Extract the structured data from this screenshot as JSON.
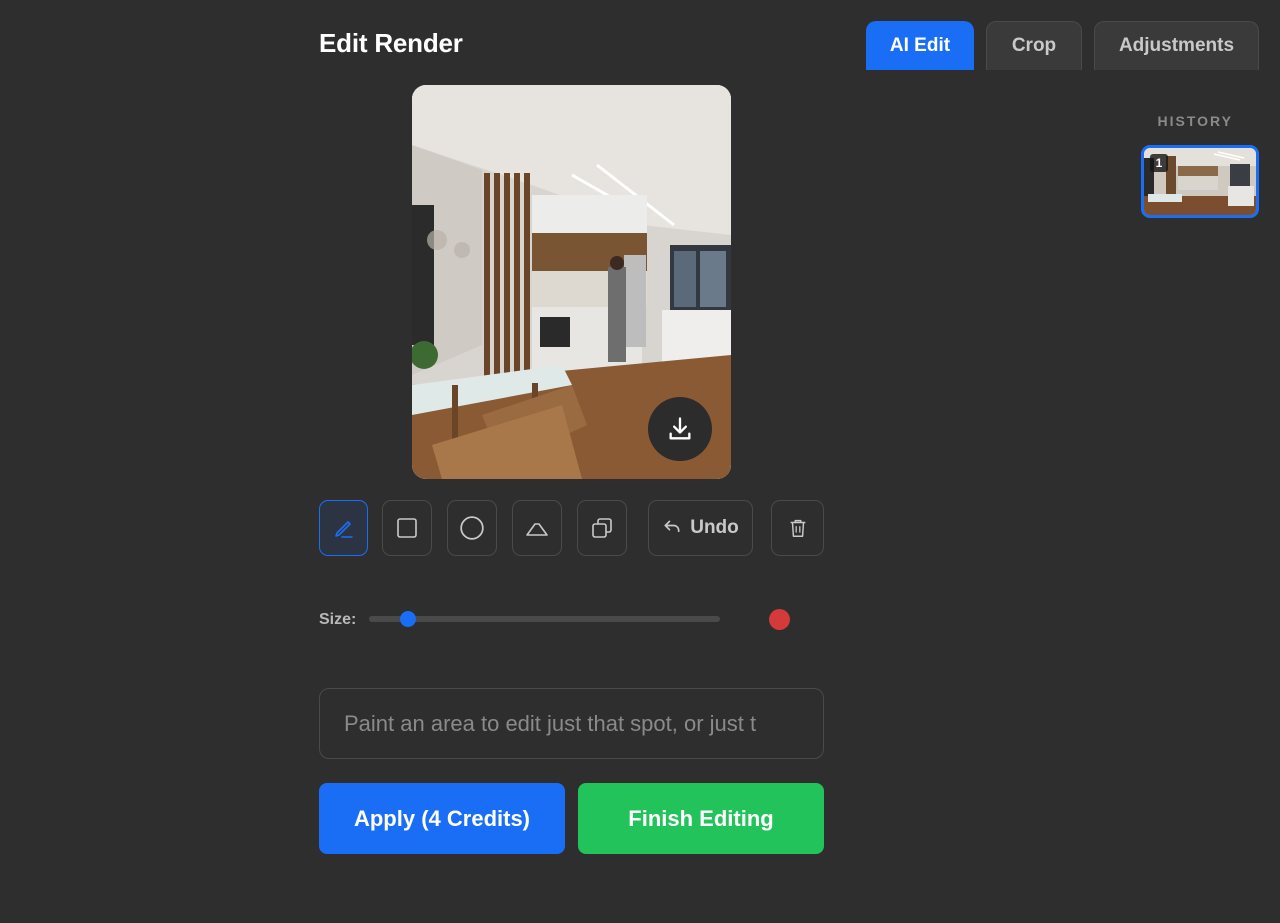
{
  "header": {
    "title": "Edit Render"
  },
  "tabs": [
    {
      "label": "AI Edit",
      "active": true
    },
    {
      "label": "Crop",
      "active": false
    },
    {
      "label": "Adjustments",
      "active": false
    }
  ],
  "history": {
    "label": "HISTORY",
    "items": [
      {
        "number": "1"
      }
    ]
  },
  "toolbar": {
    "tools": [
      {
        "icon": "pencil-icon",
        "active": true
      },
      {
        "icon": "square-icon",
        "active": false
      },
      {
        "icon": "circle-icon",
        "active": false
      },
      {
        "icon": "triangle-icon",
        "active": false
      },
      {
        "icon": "copy-icon",
        "active": false
      }
    ],
    "undo_label": "Undo"
  },
  "size": {
    "label": "Size:",
    "value_fraction": 0.11
  },
  "brush_color": "#d53a3a",
  "prompt": {
    "value": "",
    "placeholder": "Paint an area to edit just that spot, or just t"
  },
  "actions": {
    "apply_label": "Apply (4 Credits)",
    "finish_label": "Finish Editing"
  },
  "colors": {
    "accent": "#1a6ef5",
    "success": "#22c35a",
    "background": "#2e2e2e"
  }
}
